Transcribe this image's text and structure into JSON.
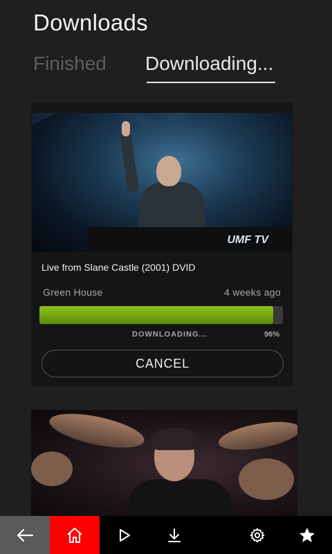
{
  "header": {
    "title": "Downloads"
  },
  "tabs": [
    {
      "label": "Finished",
      "active": false
    },
    {
      "label": "Downloading...",
      "active": true
    }
  ],
  "downloads": [
    {
      "title": "Live from Slane Castle (2001) DVID",
      "channel": "Green House",
      "age": "4 weeks ago",
      "status": "DOWNLOADING...",
      "percent_label": "96%",
      "progress": 0.96,
      "cancel_label": "CANCEL",
      "thumbnail_logo": "UMF TV"
    }
  ],
  "nav": {
    "items": [
      {
        "icon": "back-arrow-icon"
      },
      {
        "icon": "home-icon",
        "active": true
      },
      {
        "icon": "play-icon"
      },
      {
        "icon": "download-icon"
      },
      {
        "icon": "gear-icon"
      },
      {
        "icon": "star-icon"
      }
    ]
  },
  "colors": {
    "accent": "#ff0000",
    "progress": "#7cb518",
    "background": "#1f1f1f"
  }
}
